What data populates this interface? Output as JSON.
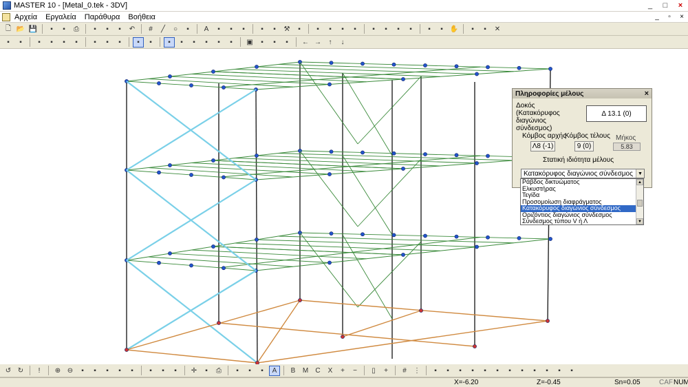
{
  "window": {
    "title": "MASTER 10 - [Metal_0.tek - 3DV]",
    "controls": [
      "_",
      "□",
      "×"
    ]
  },
  "menu": {
    "items": [
      "Αρχεία",
      "Εργαλεία",
      "Παράθυρα",
      "Βοήθεια"
    ],
    "mdi_controls": [
      "_",
      "▫",
      "×"
    ]
  },
  "toolbar_icons": {
    "row1": [
      "new-file",
      "open-folder",
      "save",
      "import",
      "copy",
      "print",
      "print-preview",
      "cut",
      "edit",
      "undo",
      "grid",
      "line",
      "circle",
      "arc",
      "text",
      "dimension",
      "column",
      "beam",
      "slab",
      "wall",
      "hammer",
      "tools",
      "view3d",
      "plan",
      "section",
      "select",
      "move",
      "rotate",
      "mirror",
      "array",
      "measure",
      "node",
      "hand",
      "pan",
      "zoom-window",
      "erase"
    ],
    "row2": [
      "snap",
      "axes",
      "layer",
      "color",
      "material",
      "load",
      "support",
      "element",
      "release",
      "member-prop",
      "section-prop",
      "3d-wire",
      "3d-solid",
      "frame",
      "building",
      "house",
      "roof",
      "cube",
      "stairs",
      "truss",
      "beam-grid",
      "arrow-left",
      "arrow-right",
      "arrow-up",
      "arrow-down"
    ],
    "row3": [
      "rotate-left",
      "rotate-right",
      "mark",
      "zoom-in",
      "zoom-out",
      "zoom-extents",
      "zoom-window",
      "zoom-prev",
      "view",
      "settings",
      "crop",
      "wall",
      "axis",
      "cross",
      "transform",
      "print",
      "window",
      "table",
      "copy",
      "text-a",
      "text-b",
      "text-m",
      "text-c",
      "text-x",
      "plus",
      "minus",
      "mouse",
      "cross-hair",
      "grid",
      "dots",
      "line1",
      "line2",
      "line3",
      "line4",
      "line5",
      "line6",
      "line7",
      "line8",
      "line9",
      "line10",
      "line11",
      "line12"
    ]
  },
  "panel": {
    "title": "Πληροφορίες μέλους",
    "member_description": "Δοκός (Κατακόρυφος διαγώνιος σύνδεσμος)",
    "member_id": "Δ 13.1 (0)",
    "start_node_label": "Κόμβος αρχής",
    "start_node_value": "Λ8 (-1)",
    "end_node_label": "Κόμβος τέλους",
    "end_node_value": "9 (0)",
    "length_label": "Μήκος",
    "length_value": "5.83",
    "static_label": "Στατική ιδιότητα μέλους",
    "static_selected": "Κατακόρυφος διαγώνιος σύνδεσμος"
  },
  "static_options": {
    "items": [
      "Ράβδος δικτυώματος",
      "Ελκυστήρας",
      "Τεγίδα",
      "Προσομοίωση διαφράγματος",
      "Κατακόρυφος διαγώνιος σύνδεσμος",
      "Οριζόντιος διαγώνιος σύνδεσμος",
      "Σύνδεσμος τύπου V ή Λ"
    ],
    "selected_index": 4
  },
  "status": {
    "x": "X=-6.20",
    "z": "Z=-0.45",
    "sn": "Sn=0.05",
    "caf": "CAF",
    "num": "NUM"
  },
  "colors": {
    "column": "#222222",
    "floor_beam": "#3a8a3a",
    "diagonal_brace": "#7ad0e8",
    "foundation": "#d08a40",
    "node": "#2255cc",
    "support_node": "#cc3333"
  }
}
